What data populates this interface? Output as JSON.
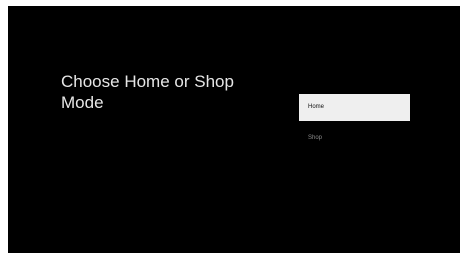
{
  "screen": {
    "title": "Choose Home or Shop Mode",
    "options": [
      {
        "label": "Home",
        "selected": true
      },
      {
        "label": "Shop",
        "selected": false
      }
    ]
  },
  "colors": {
    "background": "#000000",
    "title_text": "#e6e6e6",
    "selected_option_background": "#efefef",
    "selected_option_text": "#111111",
    "unselected_option_text": "#8c8c8c"
  }
}
